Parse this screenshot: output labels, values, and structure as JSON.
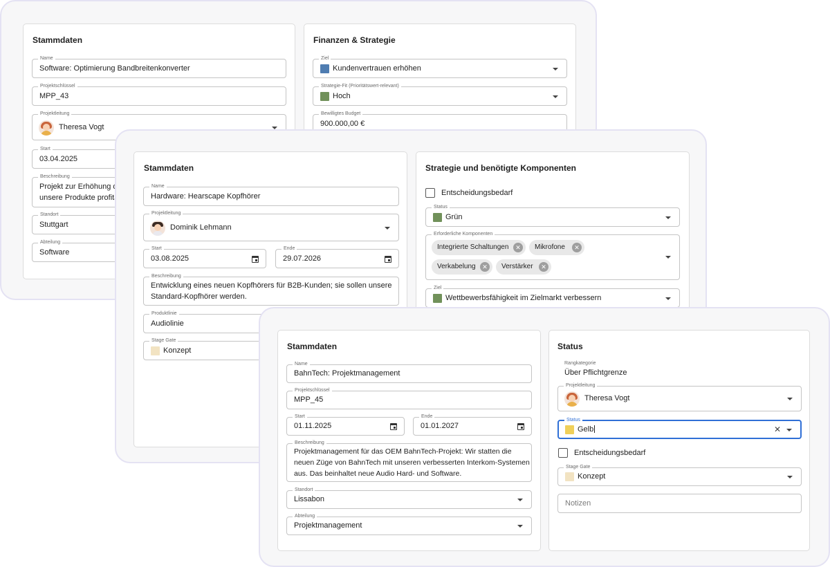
{
  "colors": {
    "blue": "#4f7db1",
    "green": "#71915a",
    "yellow": "#f0d05a",
    "beige": "#f2e3c2",
    "focus": "#2f6fd6"
  },
  "w1": {
    "stammdaten": {
      "title": "Stammdaten",
      "name_label": "Name",
      "name": "Software: Optimierung Bandbreitenkonverter",
      "key_label": "Projektschlüssel",
      "key": "MPP_43",
      "lead_label": "Projektleitung",
      "lead": "Theresa Vogt",
      "start_label": "Start",
      "start": "03.04.2025",
      "desc_label": "Beschreibung",
      "desc_line1": "Projekt zur Erhöhung de",
      "desc_line2": "unsere Produkte profita",
      "location_label": "Standort",
      "location": "Stuttgart",
      "dept_label": "Abteilung",
      "dept": "Software"
    },
    "finanzen": {
      "title": "Finanzen & Strategie",
      "goal_label": "Ziel",
      "goal": "Kundenvertrauen erhöhen",
      "fit_label": "Strategie-Fit (Prioritätswert-relevant)",
      "fit": "Hoch",
      "budget_label": "Bewilligtes Budget",
      "budget": "900.000,00 €"
    }
  },
  "w2": {
    "stammdaten": {
      "title": "Stammdaten",
      "name_label": "Name",
      "name": "Hardware: Hearscape Kopfhörer",
      "lead_label": "Projektleitung",
      "lead": "Dominik Lehmann",
      "start_label": "Start",
      "start": "03.08.2025",
      "end_label": "Ende",
      "end": "29.07.2026",
      "desc_label": "Beschreibung",
      "desc_line1": "Entwicklung eines neuen Kopfhörers für B2B-Kunden; sie sollen unsere",
      "desc_line2": "Standard-Kopfhörer werden.",
      "line_label": "Produktlinie",
      "line": "Audiolinie",
      "gate_label": "Stage Gate",
      "gate": "Konzept"
    },
    "strategie": {
      "title": "Strategie und benötigte Komponenten",
      "decision": "Entscheidungsbedarf",
      "status_label": "Status",
      "status": "Grün",
      "components_label": "Erforderliche Komponenten",
      "components": [
        "Integrierte Schaltungen",
        "Mikrofone",
        "Verkabelung",
        "Verstärker"
      ],
      "goal_label": "Ziel",
      "goal": "Wettbewerbsfähigkeit im Zielmarkt verbessern"
    }
  },
  "w3": {
    "stammdaten": {
      "title": "Stammdaten",
      "name_label": "Name",
      "name": "BahnTech: Projektmanagement",
      "key_label": "Projektschlüssel",
      "key": "MPP_45",
      "start_label": "Start",
      "start": "01.11.2025",
      "end_label": "Ende",
      "end": "01.01.2027",
      "desc_label": "Beschreibung",
      "desc_line1": "Projektmanagement für das OEM BahnTech-Projekt:  Wir statten die",
      "desc_line2": "neuen Züge von BahnTech mit unseren verbesserten Interkom-Systemen",
      "desc_line3": "aus. Das beinhaltet neue Audio Hard- und Software.",
      "location_label": "Standort",
      "location": "Lissabon",
      "dept_label": "Abteilung",
      "dept": "Projektmanagement"
    },
    "status": {
      "title": "Status",
      "rank_label": "Rangkategorie",
      "rank": "Über Pflichtgrenze",
      "lead_label": "Projektleitung",
      "lead": "Theresa Vogt",
      "status_label": "Status",
      "status": "Gelb",
      "decision": "Entscheidungsbedarf",
      "gate_label": "Stage Gate",
      "gate": "Konzept",
      "notes_placeholder": "Notizen"
    }
  }
}
